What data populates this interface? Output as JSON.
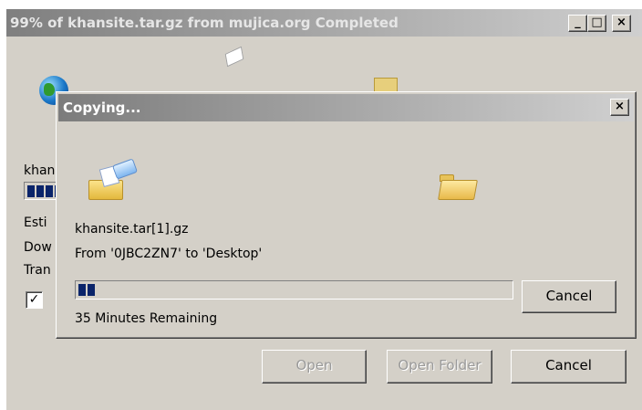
{
  "back_window": {
    "title": "99% of khansite.tar.gz from mujica.org Completed",
    "label_file": "khan",
    "label_estimated": "Esti",
    "label_download": "Dow",
    "label_transfer": "Tran",
    "close_checkbox_checked": true,
    "buttons": {
      "open": "Open",
      "open_folder": "Open Folder",
      "cancel": "Cancel"
    },
    "progress_fraction": 0.99
  },
  "copy_dialog": {
    "title": "Copying...",
    "file_name": "khansite.tar[1].gz",
    "from_to": "From '0JBC2ZN7' to 'Desktop'",
    "remaining": "35 Minutes Remaining",
    "cancel_label": "Cancel",
    "progress_fraction": 0.05,
    "close_glyph": "×"
  },
  "icons": [
    "globe-icon",
    "folder-source-icon",
    "flying-paper-icon",
    "folder-destination-icon",
    "minimize-icon",
    "maximize-icon",
    "close-icon"
  ]
}
